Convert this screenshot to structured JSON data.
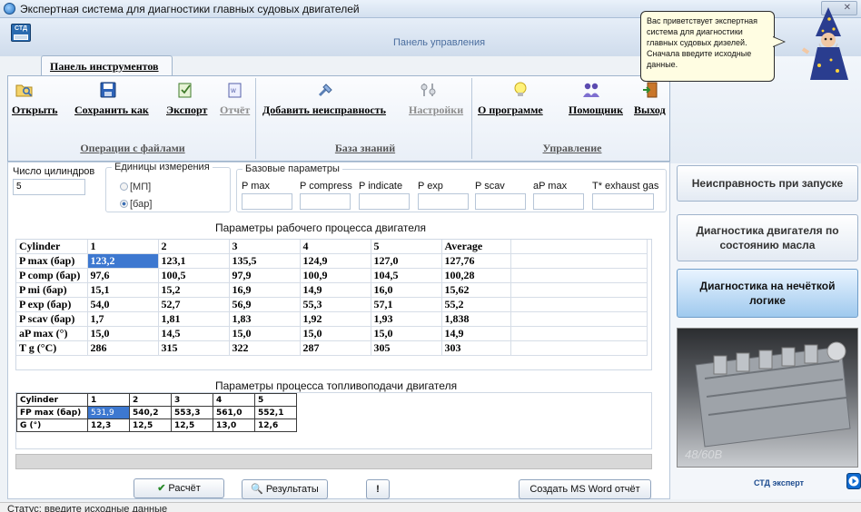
{
  "window": {
    "title": "Экспертная система для диагностики главных судовых двигателей"
  },
  "panel_title": "Панель управления",
  "ribbon": {
    "tab_label": "Панель инструментов",
    "groups": [
      {
        "name": "Операции с файлами",
        "buttons": [
          {
            "label": "Открыть",
            "icon": "open-folder-icon"
          },
          {
            "label": "Сохранить как",
            "icon": "save-floppy-icon"
          },
          {
            "label": "Экспорт",
            "icon": "export-icon"
          },
          {
            "label": "Отчёт",
            "icon": "report-icon",
            "disabled": true
          }
        ]
      },
      {
        "name": "База знаний",
        "buttons": [
          {
            "label": "Добавить неисправность",
            "icon": "add-fault-icon"
          },
          {
            "label": "Настройки",
            "icon": "settings-icon",
            "disabled": true
          }
        ]
      },
      {
        "name": "Управление",
        "buttons": [
          {
            "label": "О программе",
            "icon": "lightbulb-icon"
          },
          {
            "label": "Помощник",
            "icon": "helper-icon"
          },
          {
            "label": "Выход",
            "icon": "exit-door-icon"
          }
        ]
      }
    ]
  },
  "assistant": {
    "message": "Вас приветствует экспертная система для диагностики главных судовых дизелей. Сначала введите исходные данные."
  },
  "inputs": {
    "cylinders_label": "Число цилиндров",
    "cylinders_value": "5",
    "units_label": "Единицы измерения",
    "units_options": [
      "[МП]",
      "[бар]"
    ],
    "units_selected": "[бар]",
    "base_params_label": "Базовые параметры",
    "base_params": [
      "P max",
      "P compress",
      "P indicate",
      "P exp",
      "P scav",
      "aP max",
      "T* exhaust gas"
    ]
  },
  "work_process": {
    "title": "Параметры рабочего процесса двигателя",
    "header": [
      "Cylinder",
      "1",
      "2",
      "3",
      "4",
      "5",
      "Average"
    ],
    "rows": [
      [
        "P max (бар)",
        "123,2",
        "123,1",
        "135,5",
        "124,9",
        "127,0",
        "127,76"
      ],
      [
        "P comp (бар)",
        "97,6",
        "100,5",
        "97,9",
        "100,9",
        "104,5",
        "100,28"
      ],
      [
        "P mi (бар)",
        "15,1",
        "15,2",
        "16,9",
        "14,9",
        "16,0",
        "15,62"
      ],
      [
        "P exp (бар)",
        "54,0",
        "52,7",
        "56,9",
        "55,3",
        "57,1",
        "55,2"
      ],
      [
        "P scav (бар)",
        "1,7",
        "1,81",
        "1,83",
        "1,92",
        "1,93",
        "1,838"
      ],
      [
        "aP max (°)",
        "15,0",
        "14,5",
        "15,0",
        "15,0",
        "15,0",
        "14,9"
      ],
      [
        "T g (°C)",
        "286",
        "315",
        "322",
        "287",
        "305",
        "303"
      ]
    ]
  },
  "fuel_process": {
    "title": "Параметры процесса топливоподачи двигателя",
    "header": [
      "Cylinder",
      "1",
      "2",
      "3",
      "4",
      "5"
    ],
    "rows": [
      [
        "FP max (бар)",
        "531,9",
        "540,2",
        "553,3",
        "561,0",
        "552,1"
      ],
      [
        "G (°)",
        "12,3",
        "12,5",
        "12,5",
        "13,0",
        "12,6"
      ]
    ]
  },
  "buttons": {
    "calc": "Расчёт",
    "results": "Результаты",
    "info": "!",
    "word_report": "Создать MS Word отчёт"
  },
  "right_panel": {
    "start_fault": "Неисправность при запуске",
    "oil_diag": "Диагностика двигателя по состоянию масла",
    "fuzzy_diag": "Диагностика на нечёткой логике",
    "engine_model": "48/60B",
    "footer_label": "СТД эксперт"
  },
  "status": "Статус: введите исходные данные",
  "colors": {
    "selection": "#3d78d0",
    "active_button": "#9fc9ee"
  }
}
